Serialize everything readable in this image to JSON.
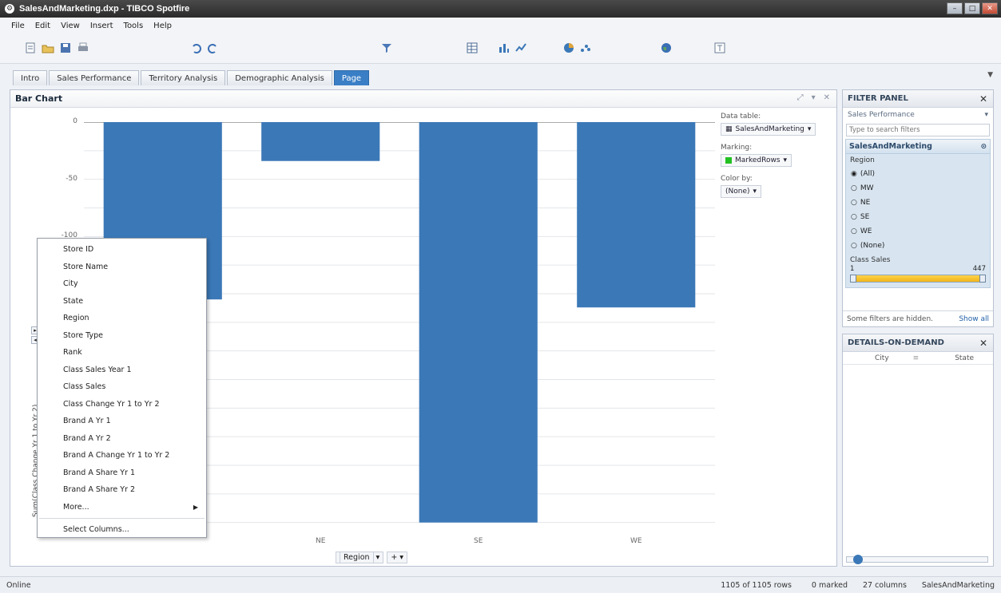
{
  "window": {
    "title": "SalesAndMarketing.dxp - TIBCO Spotfire"
  },
  "menu": [
    "File",
    "Edit",
    "View",
    "Insert",
    "Tools",
    "Help"
  ],
  "toolbar_icons": [
    "new-icon",
    "open-icon",
    "save-icon",
    "print-icon",
    "undo-icon",
    "redo-icon",
    "filter-icon",
    "table-icon",
    "bar-chart-icon",
    "line-chart-icon",
    "pie-chart-icon",
    "scatter-icon",
    "map-icon",
    "text-area-icon"
  ],
  "tabs": [
    {
      "label": "Intro"
    },
    {
      "label": "Sales Performance"
    },
    {
      "label": "Territory Analysis"
    },
    {
      "label": "Demographic Analysis"
    },
    {
      "label": "Page",
      "active": true
    }
  ],
  "visualization": {
    "title": "Bar Chart",
    "y_axis_label": "Sum(Class Change Yr 1 to Yr 2)",
    "x_axis_selector": "Region",
    "data_table_label": "Data table:",
    "data_table_value": "SalesAndMarketing",
    "marking_label": "Marking:",
    "marking_value": "MarkedRows",
    "color_by_label": "Color by:",
    "color_by_value": "(None)"
  },
  "chart_data": {
    "type": "bar",
    "categories": [
      "",
      "NE",
      "SE",
      "WE"
    ],
    "values": [
      -155,
      -34,
      -350,
      -162
    ],
    "ylim": [
      -360,
      0
    ],
    "yticks": [
      0,
      -50,
      -100,
      -150
    ],
    "bar_color": "#3b78b7",
    "grid": true
  },
  "context_menu": {
    "items": [
      "Store ID",
      "Store Name",
      "City",
      "State",
      "Region",
      "Store Type",
      "Rank",
      "Class Sales Year 1",
      "Class Sales",
      "Class Change Yr 1 to Yr 2",
      "Brand A Yr 1",
      "Brand A Yr 2",
      "Brand A Change Yr 1 to Yr 2",
      "Brand A Share Yr 1",
      "Brand A Share Yr 2"
    ],
    "more": "More...",
    "select_columns": "Select Columns..."
  },
  "filter_panel": {
    "title": "FILTER PANEL",
    "group": "Sales Performance",
    "search_placeholder": "Type to search filters",
    "table": "SalesAndMarketing",
    "region_label": "Region",
    "region_options": [
      "(All)",
      "MW",
      "NE",
      "SE",
      "WE",
      "(None)"
    ],
    "class_sales_label": "Class Sales",
    "class_sales_min": "1",
    "class_sales_max": "447",
    "hidden_note": "Some filters are hidden.",
    "show_all": "Show all"
  },
  "details_on_demand": {
    "title": "DETAILS-ON-DEMAND",
    "columns": [
      "City",
      "State"
    ]
  },
  "status": {
    "left": "Online",
    "rows": "1105 of 1105 rows",
    "marked": "0 marked",
    "columns": "27 columns",
    "table": "SalesAndMarketing"
  }
}
